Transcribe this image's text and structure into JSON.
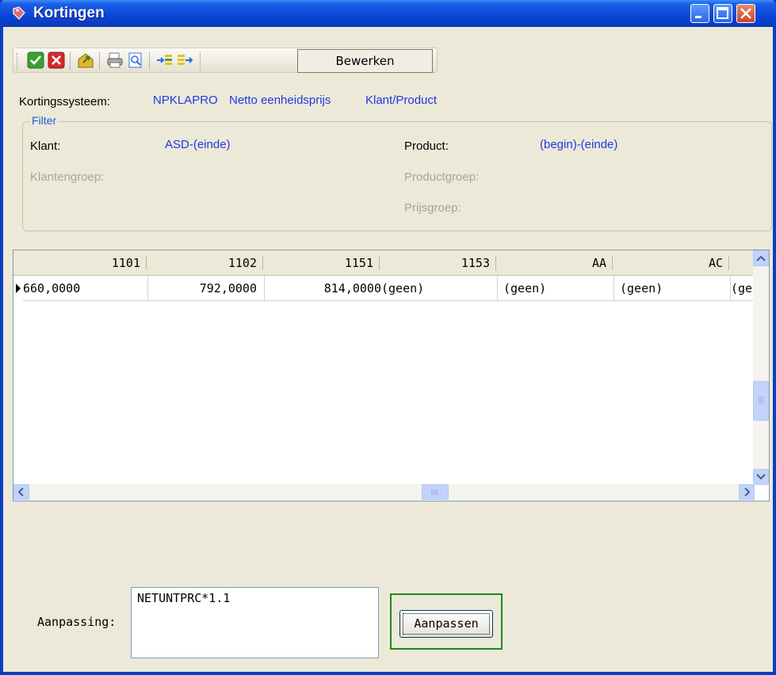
{
  "window": {
    "title": "Kortingen"
  },
  "toolbar": {
    "edit_label": "Bewerken"
  },
  "info": {
    "system_label": "Kortingssysteem:",
    "system_code": "NPKLAPRO",
    "system_desc": "Netto eenheidsprijs",
    "system_scope": "Klant/Product"
  },
  "filter": {
    "legend": "Filter",
    "klant_label": "Klant:",
    "klant_value": "ASD-(einde)",
    "klantengroep_label": "Klantengroep:",
    "product_label": "Product:",
    "product_value": "(begin)-(einde)",
    "productgroep_label": "Productgroep:",
    "prijsgroep_label": "Prijsgroep:"
  },
  "grid": {
    "columns": [
      "1101",
      "1102",
      "1151",
      "1153",
      "AA",
      "AC"
    ],
    "row": [
      "660,0000",
      "792,0000",
      "814,0000",
      "(geen)",
      "(geen)",
      "(geen)",
      "(geen"
    ]
  },
  "adjust": {
    "label": "Aanpassing:",
    "value": "NETUNTPRC*1.1",
    "button": "Aanpassen"
  }
}
